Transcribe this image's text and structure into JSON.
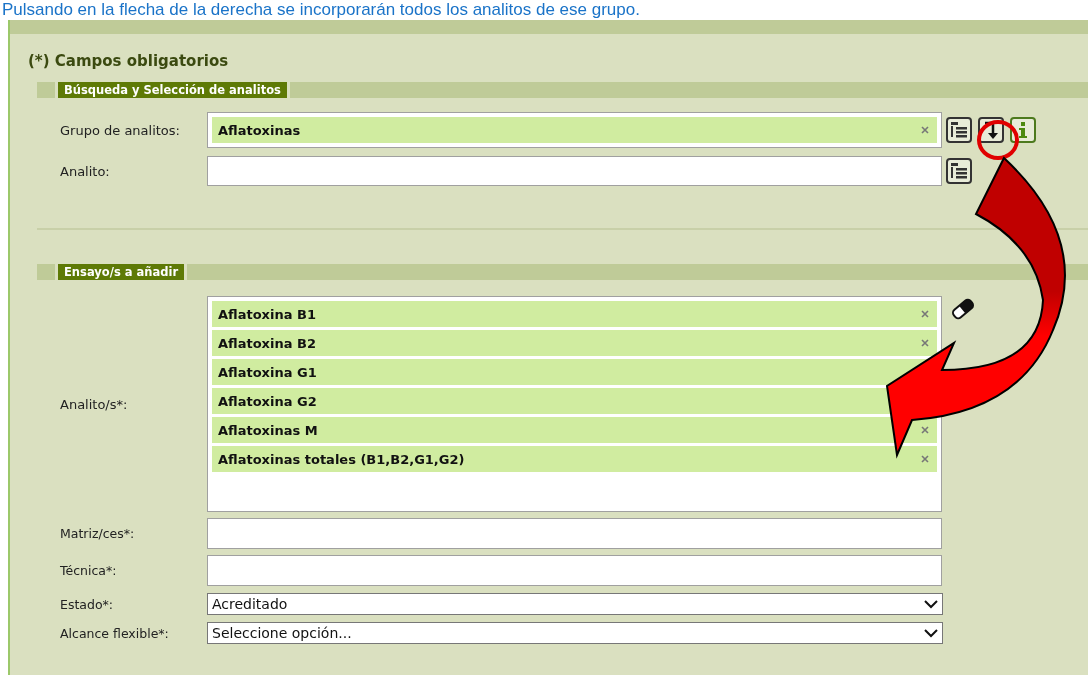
{
  "caption": "Pulsando en la flecha de la derecha se incorporarán todos los analitos de ese grupo.",
  "required_note": "(*) Campos obligatorios",
  "search_section": {
    "title": "Búsqueda y Selección de analitos",
    "fields": [
      {
        "label": "Grupo de analitos:",
        "kind": "tag",
        "value": "Aflatoxinas"
      },
      {
        "label": "Analito:",
        "kind": "text"
      }
    ]
  },
  "assay_section": {
    "title": "Ensayo/s a añadir",
    "analytes": {
      "label": "Analito/s*:",
      "items": [
        "Aflatoxina B1",
        "Aflatoxina B2",
        "Aflatoxina G1",
        "Aflatoxina G2",
        "Aflatoxinas M",
        "Aflatoxinas totales (B1,B2,G1,G2)"
      ]
    },
    "fields": [
      {
        "label": "Matriz/ces*:",
        "kind": "text"
      },
      {
        "label": "Técnica*:",
        "kind": "text"
      },
      {
        "label": "Estado*:",
        "kind": "select",
        "value": "Acreditado"
      },
      {
        "label": "Alcance flexible*:",
        "kind": "select",
        "value": "Seleccione opción..."
      }
    ]
  }
}
